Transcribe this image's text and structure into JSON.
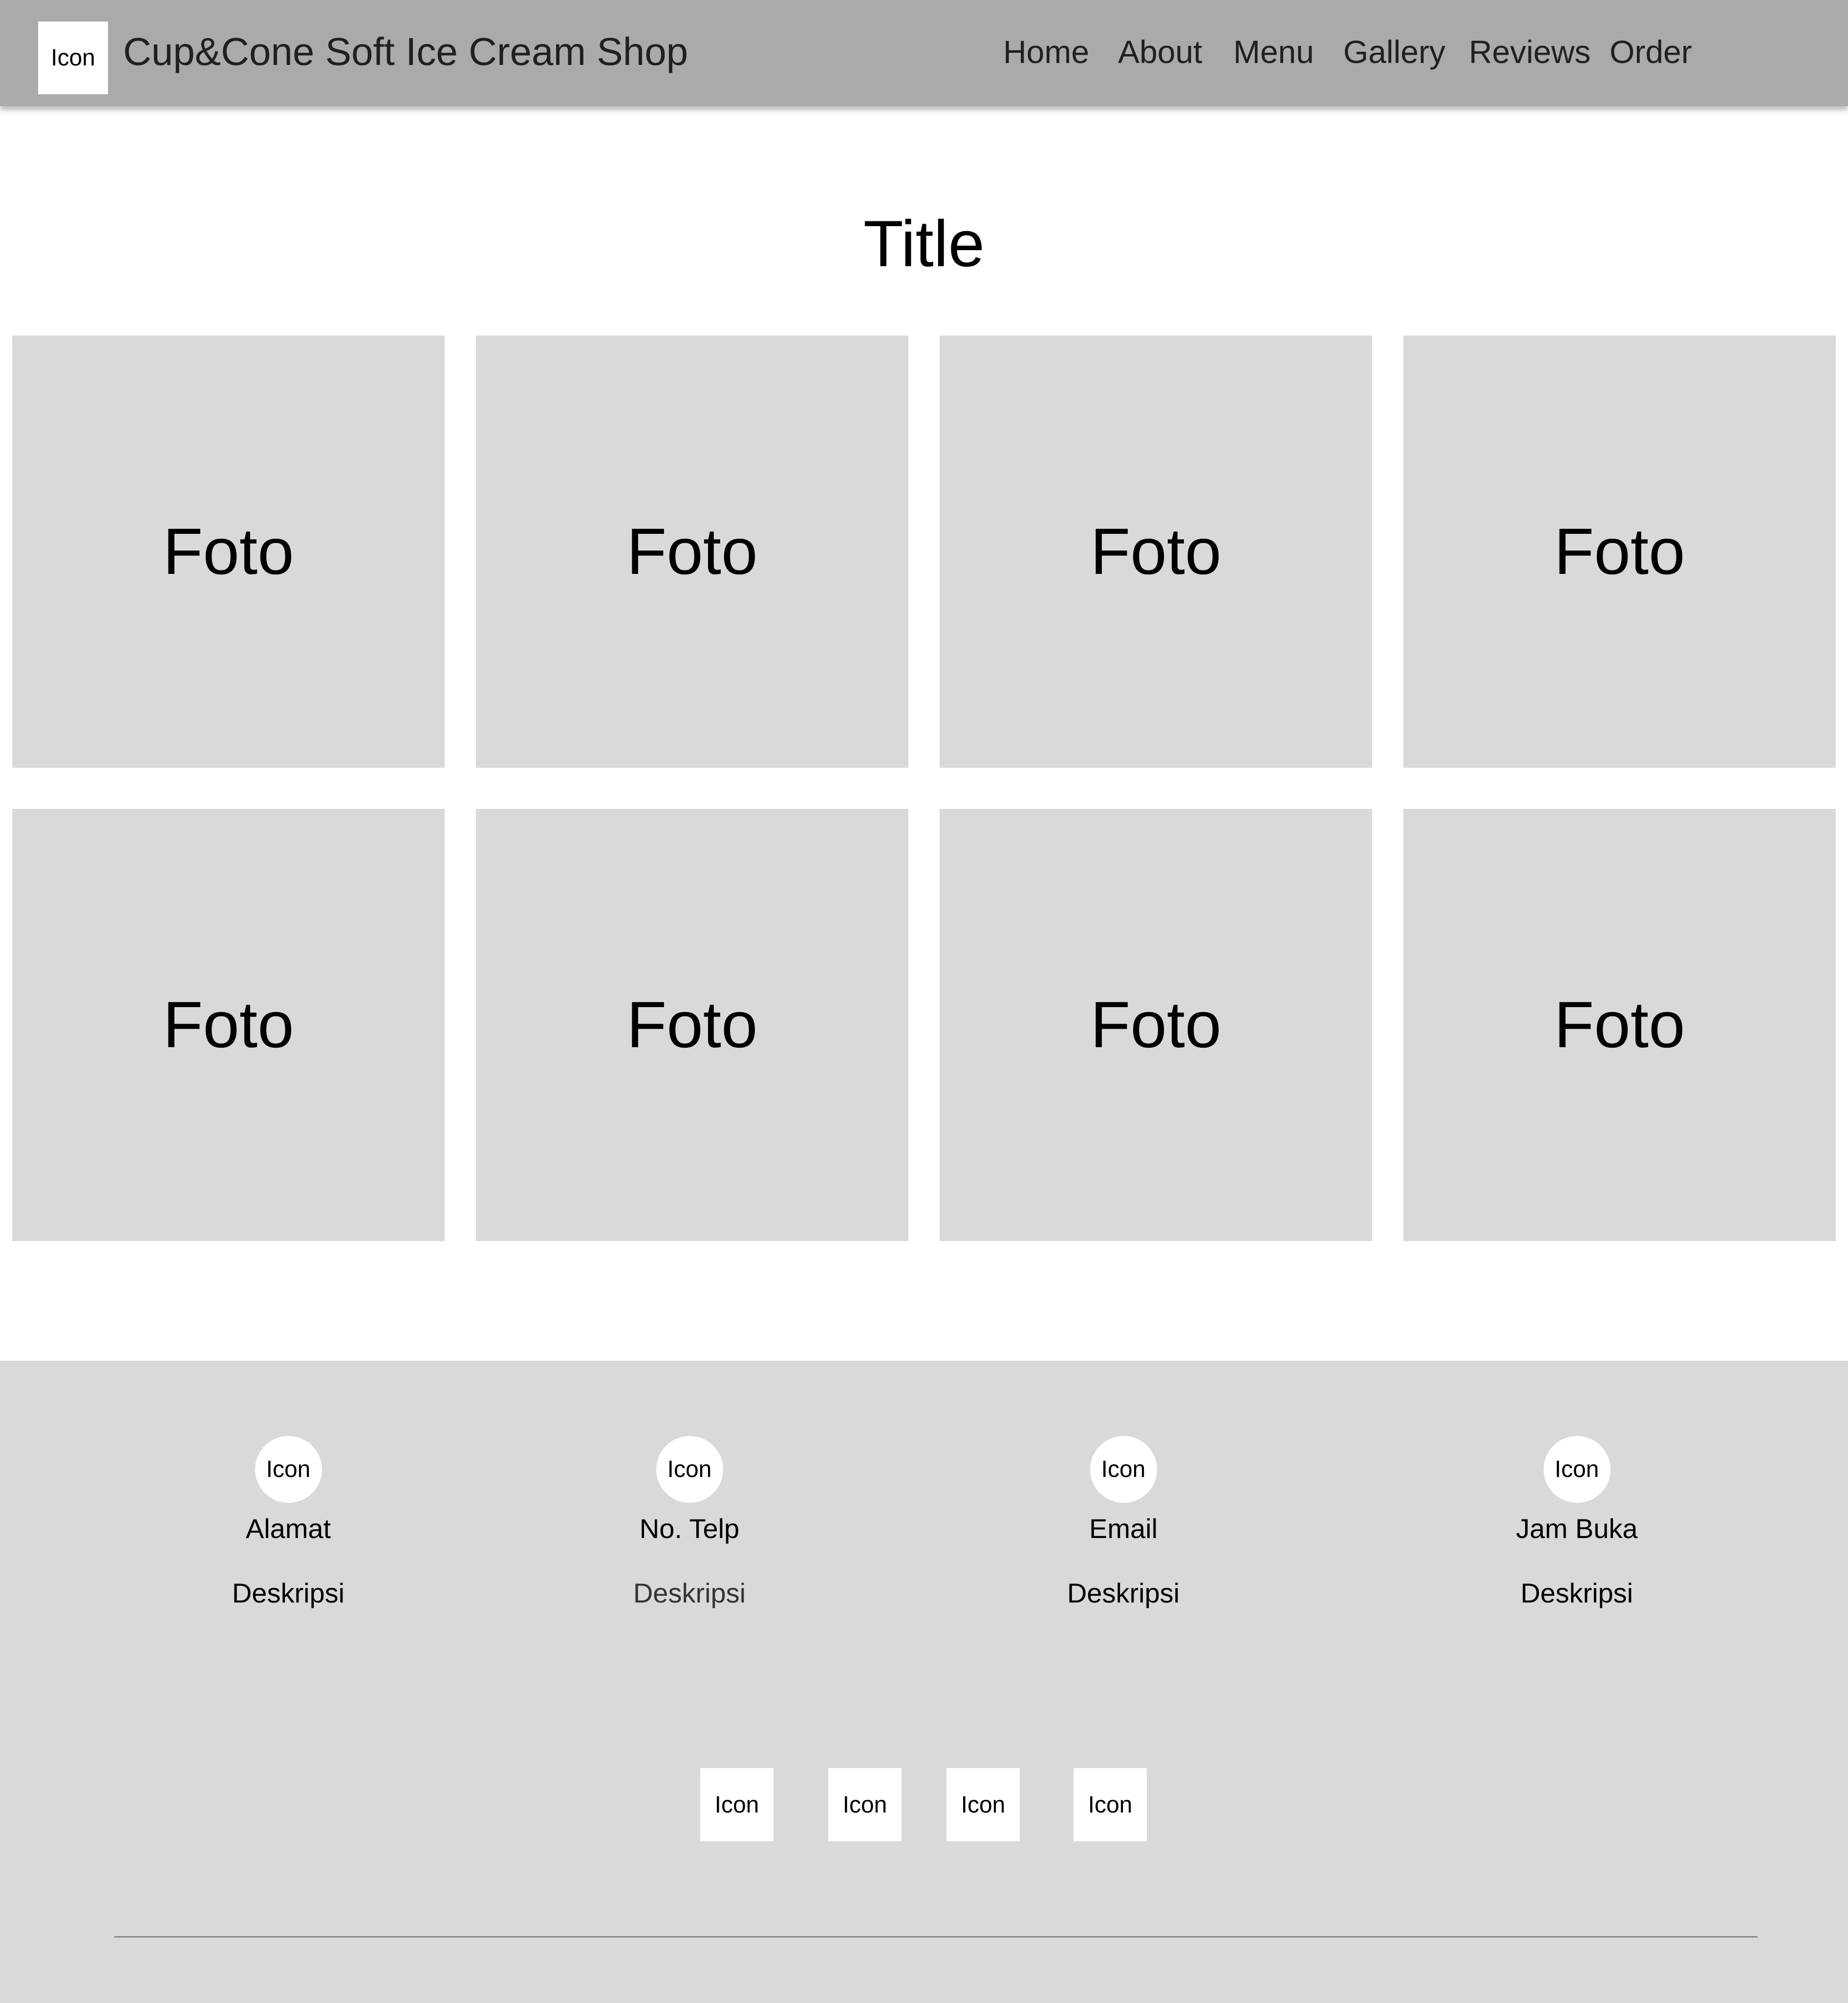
{
  "header": {
    "logo_label": "Icon",
    "brand_name": "Cup&Cone Soft Ice Cream Shop",
    "nav": [
      {
        "label": "Home"
      },
      {
        "label": "About"
      },
      {
        "label": "Menu"
      },
      {
        "label": "Gallery"
      },
      {
        "label": "Reviews"
      },
      {
        "label": "Order"
      }
    ]
  },
  "gallery": {
    "title": "Title",
    "photos": [
      {
        "label": "Foto"
      },
      {
        "label": "Foto"
      },
      {
        "label": "Foto"
      },
      {
        "label": "Foto"
      },
      {
        "label": "Foto"
      },
      {
        "label": "Foto"
      },
      {
        "label": "Foto"
      },
      {
        "label": "Foto"
      }
    ]
  },
  "footer": {
    "contacts": [
      {
        "icon_label": "Icon",
        "label": "Alamat",
        "description": "Deskripsi"
      },
      {
        "icon_label": "Icon",
        "label": "No. Telp",
        "description": "Deskripsi"
      },
      {
        "icon_label": "Icon",
        "label": "Email",
        "description": "Deskripsi"
      },
      {
        "icon_label": "Icon",
        "label": "Jam Buka",
        "description": "Deskripsi"
      }
    ],
    "social_icons": [
      {
        "label": "Icon"
      },
      {
        "label": "Icon"
      },
      {
        "label": "Icon"
      },
      {
        "label": "Icon"
      }
    ]
  },
  "colors": {
    "header_bg": "#aaaaaa",
    "placeholder_bg": "#d9d9d9",
    "footer_bg": "#d9d9d9",
    "icon_bg": "#ffffff"
  }
}
